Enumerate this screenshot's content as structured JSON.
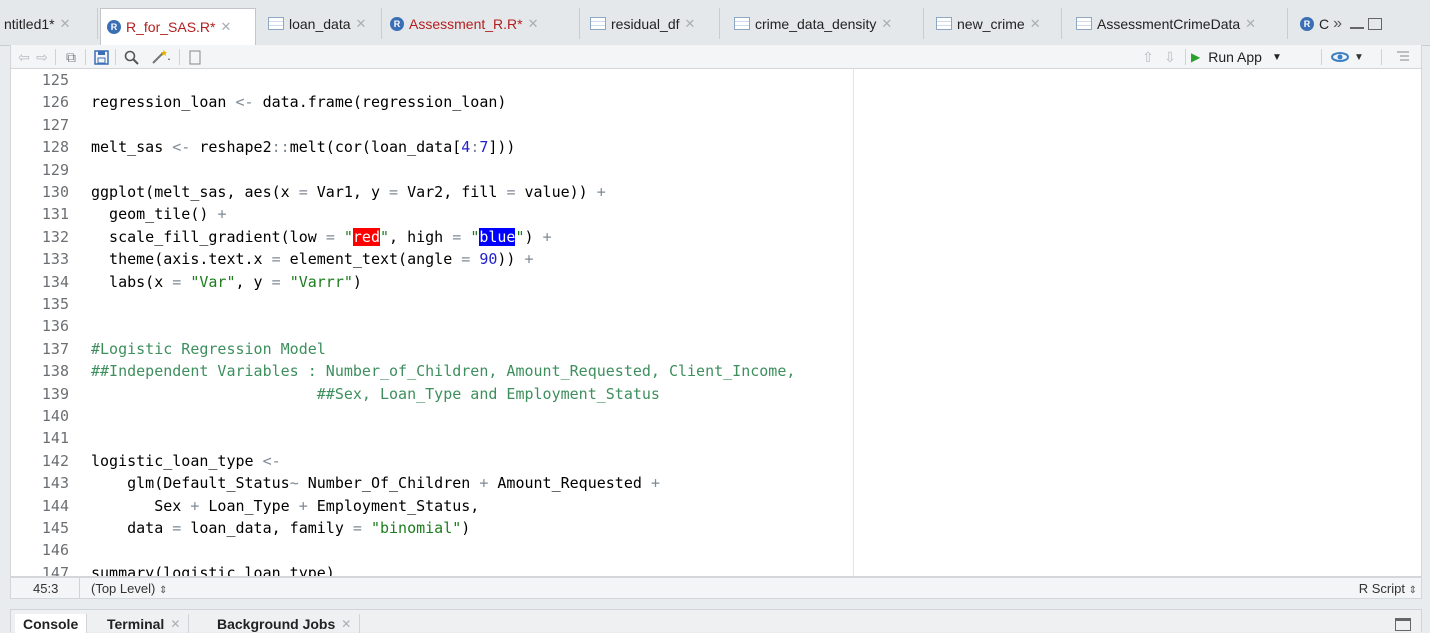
{
  "source_tabs": [
    {
      "label": "ntitled1*",
      "icon": "none",
      "modified": false
    },
    {
      "label": "R_for_SAS.R*",
      "icon": "r-script-icon",
      "modified": true
    },
    {
      "label": "loan_data",
      "icon": "data-grid-icon",
      "modified": false
    },
    {
      "label": "Assessment_R.R*",
      "icon": "r-script-icon",
      "modified": true
    },
    {
      "label": "residual_df",
      "icon": "data-grid-icon",
      "modified": false
    },
    {
      "label": "crime_data_density",
      "icon": "data-grid-icon",
      "modified": false
    },
    {
      "label": "new_crime",
      "icon": "data-grid-icon",
      "modified": false
    },
    {
      "label": "AssessmentCrimeData",
      "icon": "data-grid-icon",
      "modified": false
    },
    {
      "label": "C",
      "icon": "r-script-icon",
      "modified": false
    }
  ],
  "toolbar": {
    "run_app_label": "Run App"
  },
  "editor": {
    "line_numbers": [
      "125",
      "126",
      "127",
      "128",
      "129",
      "130",
      "131",
      "132",
      "133",
      "134",
      "135",
      "136",
      "137",
      "138",
      "139",
      "140",
      "141",
      "142",
      "143",
      "144",
      "145",
      "146",
      "147"
    ]
  },
  "status": {
    "position": "45:3",
    "scope": "(Top Level)",
    "file_type": "R Script"
  },
  "console_tabs": [
    {
      "label": "Console",
      "closable": false
    },
    {
      "label": "Terminal",
      "closable": true
    },
    {
      "label": "Background Jobs",
      "closable": true
    }
  ],
  "colors": {
    "string": "#1d7d1d",
    "number": "#2222cc",
    "comment": "#3d8f5d",
    "operator": "#7d8a96",
    "modified_tab": "#b31f1f"
  }
}
